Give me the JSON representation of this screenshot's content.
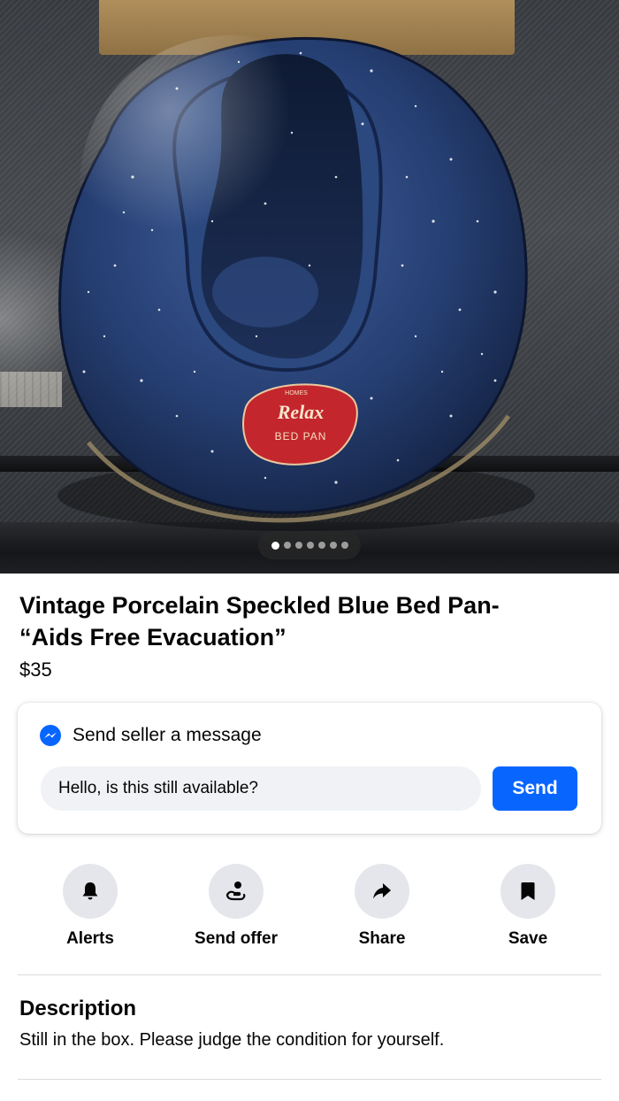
{
  "photo": {
    "subject": "speckled blue enamel bed pan",
    "label_lines": [
      "HOMES",
      "Relax",
      "BED PAN"
    ],
    "carousel": {
      "total": 7,
      "active_index": 0
    }
  },
  "listing": {
    "title": "Vintage Porcelain Speckled Blue Bed  Pan-\n“Aids Free Evacuation”",
    "price": "$35"
  },
  "message": {
    "header": "Send seller a message",
    "input_value": "Hello, is this still available?",
    "send_label": "Send",
    "accent": "#0866ff"
  },
  "actions": [
    {
      "label": "Alerts",
      "icon": "bell-icon"
    },
    {
      "label": "Send offer",
      "icon": "offer-hand-icon"
    },
    {
      "label": "Share",
      "icon": "share-arrow-icon"
    },
    {
      "label": "Save",
      "icon": "bookmark-icon"
    }
  ],
  "description": {
    "heading": "Description",
    "text": "Still in the box.  Please judge the condition for yourself."
  }
}
